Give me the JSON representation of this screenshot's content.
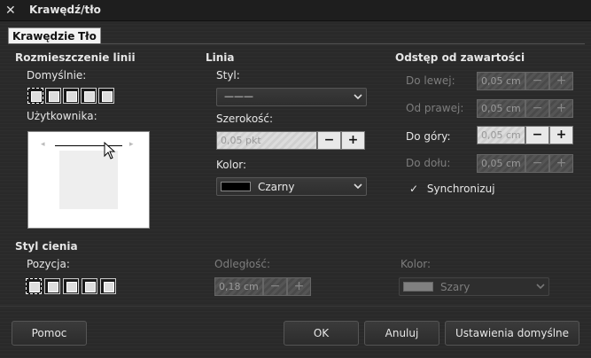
{
  "window": {
    "title": "Krawędź/tło",
    "close_glyph": "✕"
  },
  "tabs": [
    {
      "label": "Krawędzie"
    },
    {
      "label": "Tło"
    }
  ],
  "border_arrangement": {
    "heading": "Rozmieszczenie linii",
    "default_label": "Domyślnie:",
    "user_label": "Użytkownika:"
  },
  "line": {
    "heading": "Linia",
    "style_label": "Styl:",
    "style_value": "———",
    "width_label": "Szerokość:",
    "width_value": "0,05 pkt",
    "color_label": "Kolor:",
    "color_value": "Czarny",
    "color_hex": "#000000"
  },
  "padding": {
    "heading": "Odstęp od zawartości",
    "left_label": "Do lewej:",
    "left_value": "0,05 cm",
    "right_label": "Od prawej:",
    "right_value": "0,05 cm",
    "top_label": "Do góry:",
    "top_value": "0,05 cm",
    "bottom_label": "Do dołu:",
    "bottom_value": "0,05 cm",
    "sync_label": "Synchronizuj",
    "sync_glyph": "✓"
  },
  "shadow": {
    "heading": "Styl cienia",
    "position_label": "Pozycja:",
    "distance_label": "Odległość:",
    "distance_value": "0,18 cm",
    "color_label": "Kolor:",
    "color_value": "Szary",
    "color_hex": "#808080"
  },
  "spin": {
    "minus": "−",
    "plus": "+"
  },
  "buttons": {
    "help": "Pomoc",
    "ok": "OK",
    "cancel": "Anuluj",
    "reset": "Ustawienia domyślne"
  }
}
